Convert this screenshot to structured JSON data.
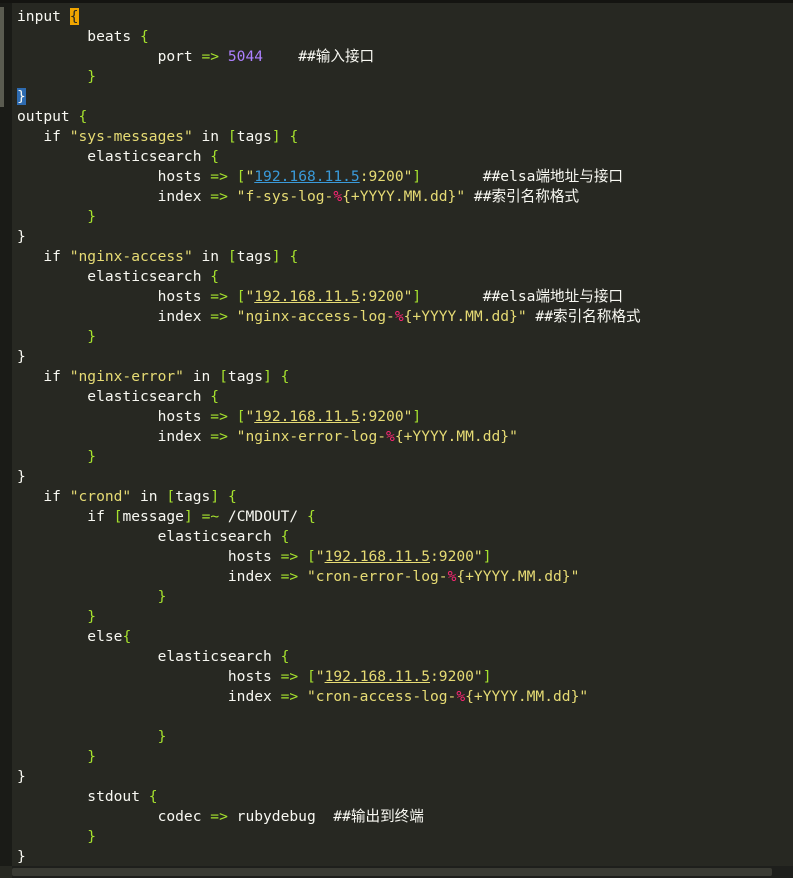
{
  "editor": {
    "lines": [
      [
        [
          "plain",
          "input "
        ],
        [
          "brace-hl",
          "{"
        ]
      ],
      [
        [
          "plain",
          "        beats "
        ],
        [
          "op",
          "{"
        ]
      ],
      [
        [
          "plain",
          "                port "
        ],
        [
          "op",
          "=>"
        ],
        [
          "plain",
          " "
        ],
        [
          "num",
          "5044"
        ],
        [
          "plain",
          "    ##输入接口"
        ]
      ],
      [
        [
          "plain",
          "        "
        ],
        [
          "op",
          "}"
        ]
      ],
      [
        [
          "brace-hl2",
          "}"
        ]
      ],
      [
        [
          "plain",
          "output "
        ],
        [
          "op",
          "{"
        ]
      ],
      [
        [
          "plain",
          "   if "
        ],
        [
          "str",
          "\"sys-messages\""
        ],
        [
          "plain",
          " in "
        ],
        [
          "op",
          "["
        ],
        [
          "plain",
          "tags"
        ],
        [
          "op",
          "]"
        ],
        [
          "plain",
          " "
        ],
        [
          "op",
          "{"
        ]
      ],
      [
        [
          "plain",
          "        elasticsearch "
        ],
        [
          "op",
          "{"
        ]
      ],
      [
        [
          "plain",
          "                hosts "
        ],
        [
          "op",
          "=>"
        ],
        [
          "plain",
          " "
        ],
        [
          "op",
          "["
        ],
        [
          "str",
          "\""
        ],
        [
          "link",
          "192.168.11.5"
        ],
        [
          "str",
          ":9200\""
        ],
        [
          "op",
          "]"
        ],
        [
          "plain",
          "       ##elsa端地址与接口"
        ]
      ],
      [
        [
          "plain",
          "                index "
        ],
        [
          "op",
          "=>"
        ],
        [
          "plain",
          " "
        ],
        [
          "str",
          "\"f-sys-log-"
        ],
        [
          "pct",
          "%"
        ],
        [
          "str",
          "{+YYYY.MM.dd}\""
        ],
        [
          "plain",
          " ##索引名称格式"
        ]
      ],
      [
        [
          "plain",
          "        "
        ],
        [
          "op",
          "}"
        ]
      ],
      [
        [
          "plain",
          "}"
        ]
      ],
      [
        [
          "plain",
          "   if "
        ],
        [
          "str",
          "\"nginx-access\""
        ],
        [
          "plain",
          " in "
        ],
        [
          "op",
          "["
        ],
        [
          "plain",
          "tags"
        ],
        [
          "op",
          "]"
        ],
        [
          "plain",
          " "
        ],
        [
          "op",
          "{"
        ]
      ],
      [
        [
          "plain",
          "        elasticsearch "
        ],
        [
          "op",
          "{"
        ]
      ],
      [
        [
          "plain",
          "                hosts "
        ],
        [
          "op",
          "=>"
        ],
        [
          "plain",
          " "
        ],
        [
          "op",
          "["
        ],
        [
          "str",
          "\""
        ],
        [
          "ulstr",
          "192.168.11.5"
        ],
        [
          "str",
          ":9200\""
        ],
        [
          "op",
          "]"
        ],
        [
          "plain",
          "       ##elsa端地址与接口"
        ]
      ],
      [
        [
          "plain",
          "                index "
        ],
        [
          "op",
          "=>"
        ],
        [
          "plain",
          " "
        ],
        [
          "str",
          "\"nginx-access-log-"
        ],
        [
          "pct",
          "%"
        ],
        [
          "str",
          "{+YYYY.MM.dd}\""
        ],
        [
          "plain",
          " ##索引名称格式"
        ]
      ],
      [
        [
          "plain",
          "        "
        ],
        [
          "op",
          "}"
        ]
      ],
      [
        [
          "plain",
          "}"
        ]
      ],
      [
        [
          "plain",
          "   if "
        ],
        [
          "str",
          "\"nginx-error\""
        ],
        [
          "plain",
          " in "
        ],
        [
          "op",
          "["
        ],
        [
          "plain",
          "tags"
        ],
        [
          "op",
          "]"
        ],
        [
          "plain",
          " "
        ],
        [
          "op",
          "{"
        ]
      ],
      [
        [
          "plain",
          "        elasticsearch "
        ],
        [
          "op",
          "{"
        ]
      ],
      [
        [
          "plain",
          "                hosts "
        ],
        [
          "op",
          "=>"
        ],
        [
          "plain",
          " "
        ],
        [
          "op",
          "["
        ],
        [
          "str",
          "\""
        ],
        [
          "ulstr",
          "192.168.11.5"
        ],
        [
          "str",
          ":9200\""
        ],
        [
          "op",
          "]"
        ]
      ],
      [
        [
          "plain",
          "                index "
        ],
        [
          "op",
          "=>"
        ],
        [
          "plain",
          " "
        ],
        [
          "str",
          "\"nginx-error-log-"
        ],
        [
          "pct",
          "%"
        ],
        [
          "str",
          "{+YYYY.MM.dd}\""
        ]
      ],
      [
        [
          "plain",
          "        "
        ],
        [
          "op",
          "}"
        ]
      ],
      [
        [
          "plain",
          "}"
        ]
      ],
      [
        [
          "plain",
          "   if "
        ],
        [
          "str",
          "\"crond\""
        ],
        [
          "plain",
          " in "
        ],
        [
          "op",
          "["
        ],
        [
          "plain",
          "tags"
        ],
        [
          "op",
          "]"
        ],
        [
          "plain",
          " "
        ],
        [
          "op",
          "{"
        ]
      ],
      [
        [
          "plain",
          "        if "
        ],
        [
          "op",
          "["
        ],
        [
          "plain",
          "message"
        ],
        [
          "op",
          "]"
        ],
        [
          "plain",
          " "
        ],
        [
          "op",
          "=~"
        ],
        [
          "plain",
          " /CMDOUT/ "
        ],
        [
          "op",
          "{"
        ]
      ],
      [
        [
          "plain",
          "                elasticsearch "
        ],
        [
          "op",
          "{"
        ]
      ],
      [
        [
          "plain",
          "                        hosts "
        ],
        [
          "op",
          "=>"
        ],
        [
          "plain",
          " "
        ],
        [
          "op",
          "["
        ],
        [
          "str",
          "\""
        ],
        [
          "ulstr",
          "192.168.11.5"
        ],
        [
          "str",
          ":9200\""
        ],
        [
          "op",
          "]"
        ]
      ],
      [
        [
          "plain",
          "                        index "
        ],
        [
          "op",
          "=>"
        ],
        [
          "plain",
          " "
        ],
        [
          "str",
          "\"cron-error-log-"
        ],
        [
          "pct",
          "%"
        ],
        [
          "str",
          "{+YYYY.MM.dd}\""
        ]
      ],
      [
        [
          "plain",
          "                "
        ],
        [
          "op",
          "}"
        ]
      ],
      [
        [
          "plain",
          "        "
        ],
        [
          "op",
          "}"
        ]
      ],
      [
        [
          "plain",
          "        else"
        ],
        [
          "op",
          "{"
        ]
      ],
      [
        [
          "plain",
          "                elasticsearch "
        ],
        [
          "op",
          "{"
        ]
      ],
      [
        [
          "plain",
          "                        hosts "
        ],
        [
          "op",
          "=>"
        ],
        [
          "plain",
          " "
        ],
        [
          "op",
          "["
        ],
        [
          "str",
          "\""
        ],
        [
          "ulstr",
          "192.168.11.5"
        ],
        [
          "str",
          ":9200\""
        ],
        [
          "op",
          "]"
        ]
      ],
      [
        [
          "plain",
          "                        index "
        ],
        [
          "op",
          "=>"
        ],
        [
          "plain",
          " "
        ],
        [
          "str",
          "\"cron-access-log-"
        ],
        [
          "pct",
          "%"
        ],
        [
          "str",
          "{+YYYY.MM.dd}\""
        ]
      ],
      [
        [
          "plain",
          ""
        ]
      ],
      [
        [
          "plain",
          "                "
        ],
        [
          "op",
          "}"
        ]
      ],
      [
        [
          "plain",
          "        "
        ],
        [
          "op",
          "}"
        ]
      ],
      [
        [
          "plain",
          "}"
        ]
      ],
      [
        [
          "plain",
          "        stdout "
        ],
        [
          "op",
          "{"
        ]
      ],
      [
        [
          "plain",
          "                codec "
        ],
        [
          "op",
          "=>"
        ],
        [
          "plain",
          " rubydebug  ##输出到终端"
        ]
      ],
      [
        [
          "plain",
          "        "
        ],
        [
          "op",
          "}"
        ]
      ],
      [
        [
          "plain",
          "}"
        ]
      ]
    ],
    "colors": {
      "background": "#272822",
      "foreground": "#f8f8f2",
      "operator": "#a6e22e",
      "number": "#ae81ff",
      "string": "#e6db74",
      "percent": "#f92672",
      "link": "#3a9ad9",
      "brace_highlight": "#f0a500"
    }
  }
}
